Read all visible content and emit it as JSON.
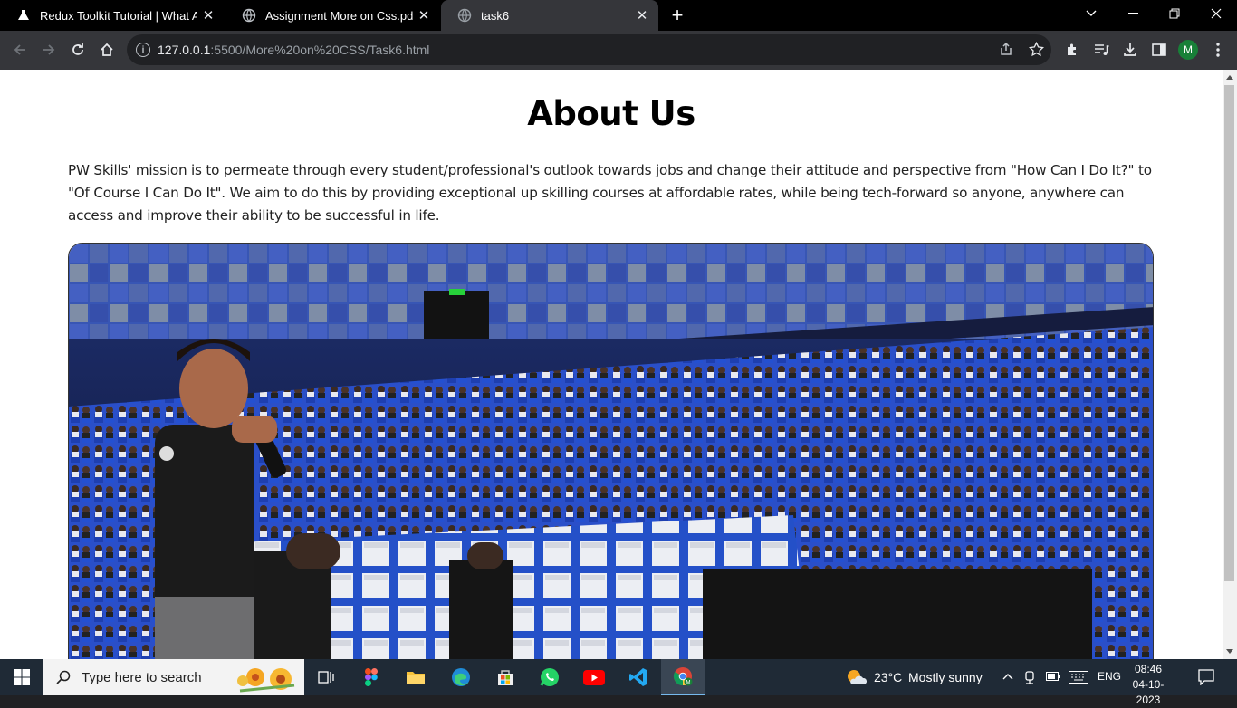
{
  "browser": {
    "tabs": [
      {
        "title": "Redux Toolkit Tutorial | What Ab",
        "active": false
      },
      {
        "title": "Assignment More on Css.pdf",
        "active": false
      },
      {
        "title": "task6",
        "active": true
      }
    ],
    "url_host": "127.0.0.1",
    "url_path": ":5500/More%20on%20CSS/Task6.html",
    "profile_initial": "M"
  },
  "page": {
    "heading": "About Us",
    "mission": "PW Skills' mission is to permeate through every student/professional's outlook towards jobs and change their attitude and perspective from \"How Can I Do It?\" to \"Of Course I Can Do It\". We aim to do this by providing exceptional up skilling courses at affordable rates, while being tech-forward so anyone, anywhere can access and improve their ability to be successful in life."
  },
  "taskbar": {
    "search_placeholder": "Type here to search",
    "weather_temp": "23°C",
    "weather_desc": "Mostly sunny",
    "language": "ENG",
    "time": "08:46",
    "date": "04-10-2023"
  },
  "colors": {
    "tab_strip": "#000000",
    "toolbar": "#35363a",
    "taskbar": "#1f2a36",
    "seat_blue": "#2a4fc9",
    "avatar": "#188038"
  }
}
